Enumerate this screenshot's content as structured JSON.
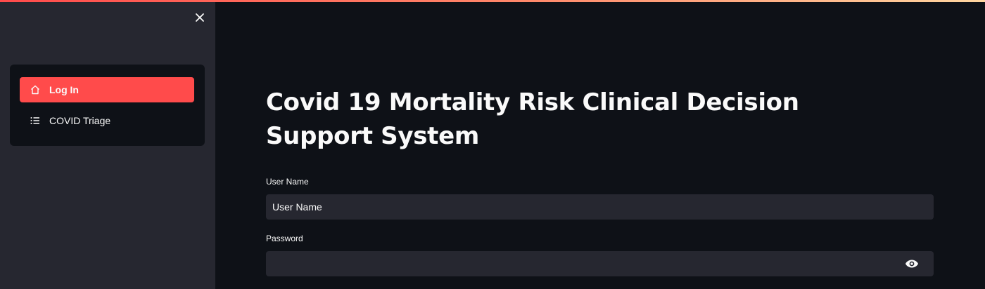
{
  "sidebar": {
    "close_icon": "close-icon",
    "items": [
      {
        "label": "Log In",
        "icon": "home-icon",
        "active": true
      },
      {
        "label": "COVID Triage",
        "icon": "list-icon",
        "active": false
      }
    ]
  },
  "main": {
    "title": "Covid 19 Mortality Risk Clinical Decision Support System",
    "username": {
      "label": "User Name",
      "placeholder": "User Name",
      "value": ""
    },
    "password": {
      "label": "Password",
      "value": "",
      "toggle_icon": "eye-icon"
    }
  },
  "colors": {
    "accent": "#ff4b4b",
    "background": "#0e1117",
    "sidebar": "#262730",
    "input": "#262730",
    "text": "#fafafa"
  }
}
